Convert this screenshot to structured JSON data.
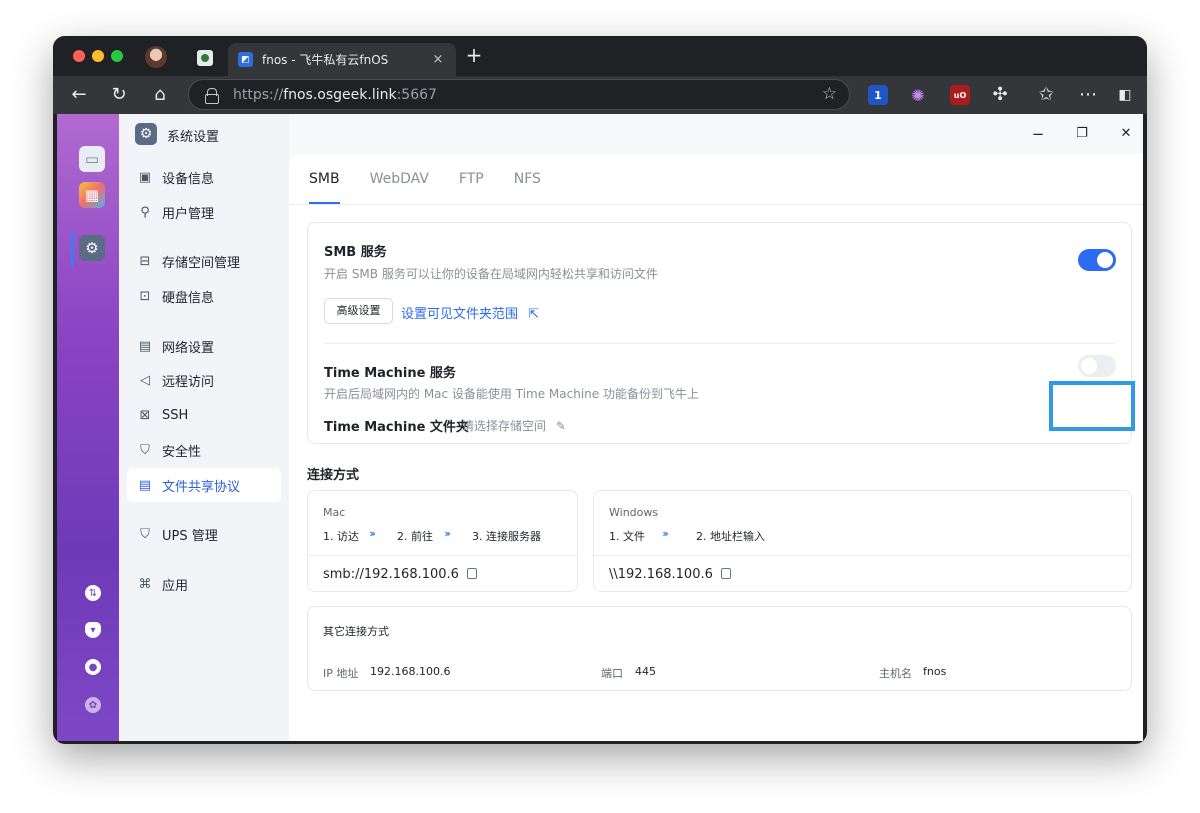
{
  "browser": {
    "tab_title": "fnos - 飞牛私有云fnOS",
    "tab_close": "×",
    "new_tab": "+",
    "url_scheme": "https://",
    "url_host": "fnos.osgeek.link",
    "url_port": ":5667",
    "ext_badge_count": "1",
    "ext_ublock": "uO"
  },
  "window": {
    "title": "系统设置",
    "minimize": "−",
    "maximize": "❐",
    "close": "✕"
  },
  "sidebar": {
    "items": [
      {
        "label": "设备信息",
        "icon": "device-icon"
      },
      {
        "label": "用户管理",
        "icon": "user-icon"
      },
      {
        "label": "存储空间管理",
        "icon": "storage-icon"
      },
      {
        "label": "硬盘信息",
        "icon": "disk-icon"
      },
      {
        "label": "网络设置",
        "icon": "network-icon"
      },
      {
        "label": "远程访问",
        "icon": "send-icon"
      },
      {
        "label": "SSH",
        "icon": "code-icon"
      },
      {
        "label": "安全性",
        "icon": "shield-icon"
      },
      {
        "label": "文件共享协议",
        "icon": "document-icon"
      },
      {
        "label": "UPS 管理",
        "icon": "shield-icon"
      },
      {
        "label": "应用",
        "icon": "apps-icon"
      }
    ],
    "active_index": 8
  },
  "tabs": [
    "SMB",
    "WebDAV",
    "FTP",
    "NFS"
  ],
  "smb": {
    "title": "SMB 服务",
    "desc": "开启 SMB 服务可以让你的设备在局域网内轻松共享和访问文件",
    "enabled": true,
    "advanced_button": "高级设置",
    "visible_scope_link": "设置可见文件夹范围",
    "time_machine_title": "Time Machine 服务",
    "time_machine_desc": "开启后局域网内的 Mac 设备能使用 Time Machine 功能备份到飞牛上",
    "time_machine_enabled": false,
    "time_machine_folder_label": "Time Machine 文件夹",
    "time_machine_folder_value": "请选择存储空间"
  },
  "connection": {
    "title": "连接方式",
    "mac": {
      "os": "Mac",
      "step1": "1. 访达",
      "step2": "2. 前往",
      "step3": "3. 连接服务器",
      "address": "smb://192.168.100.6"
    },
    "windows": {
      "os": "Windows",
      "step1": "1. 文件",
      "step2": "2. 地址栏输入",
      "address": "\\\\192.168.100.6"
    },
    "arrows": "›››",
    "other": {
      "title": "其它连接方式",
      "ip_label": "IP 地址",
      "ip_value": "192.168.100.6",
      "port_label": "端口",
      "port_value": "445",
      "host_label": "主机名",
      "host_value": "fnos"
    }
  },
  "colors": {
    "accent": "#2d6cf0",
    "highlight_box": "#2f9be6",
    "dock_purple": "#8b44c3"
  }
}
